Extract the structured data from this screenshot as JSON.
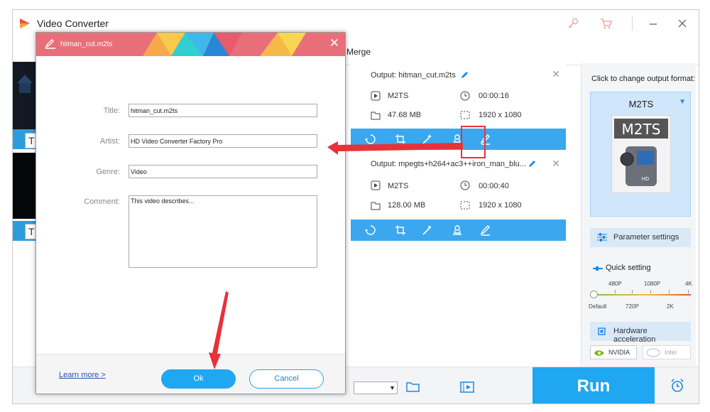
{
  "app": {
    "title": "Video Converter",
    "toolbar_merge": "Merge"
  },
  "left_thumbs": [
    {
      "label": "T"
    },
    {
      "label": "T"
    }
  ],
  "files": [
    {
      "output": "Output: hitman_cut.m2ts",
      "format": "M2TS",
      "duration": "00:00:16",
      "size": "47.68 MB",
      "resolution": "1920 x 1080"
    },
    {
      "output": "Output: mpegts+h264+ac3++iron_man_blu...",
      "format": "M2TS",
      "duration": "00:00:40",
      "size": "128.00 MB",
      "resolution": "1920 x 1080"
    }
  ],
  "right_panel": {
    "caption": "Click to change output format:",
    "format_name": "M2TS",
    "format_image_text": "M2TS",
    "format_image_sub": "HD",
    "parameter_settings": "Parameter settings",
    "quick_setting": "Quick setting",
    "quality_top": [
      "480P",
      "1080P",
      "4K"
    ],
    "quality_bottom": [
      "Default",
      "720P",
      "2K"
    ],
    "hardware_acceleration": "Hardware acceleration",
    "nvidia": "NVIDIA",
    "intel": "Intel"
  },
  "bottom": {
    "run": "Run"
  },
  "dialog": {
    "title": "hitman_cut.m2ts",
    "labels": {
      "title": "Title:",
      "artist": "Artist:",
      "genre": "Genre:",
      "comment": "Comment:"
    },
    "values": {
      "title": "hitman_cut.m2ts",
      "artist": "HD Video Converter Factory Pro",
      "genre": "Video",
      "comment": "This video describes..."
    },
    "learn_more": "Learn more >",
    "ok": "Ok",
    "cancel": "Cancel"
  },
  "colors": {
    "accent": "#1fa7f1",
    "bar": "#3ba7ee",
    "annotation": "#e8313a"
  }
}
